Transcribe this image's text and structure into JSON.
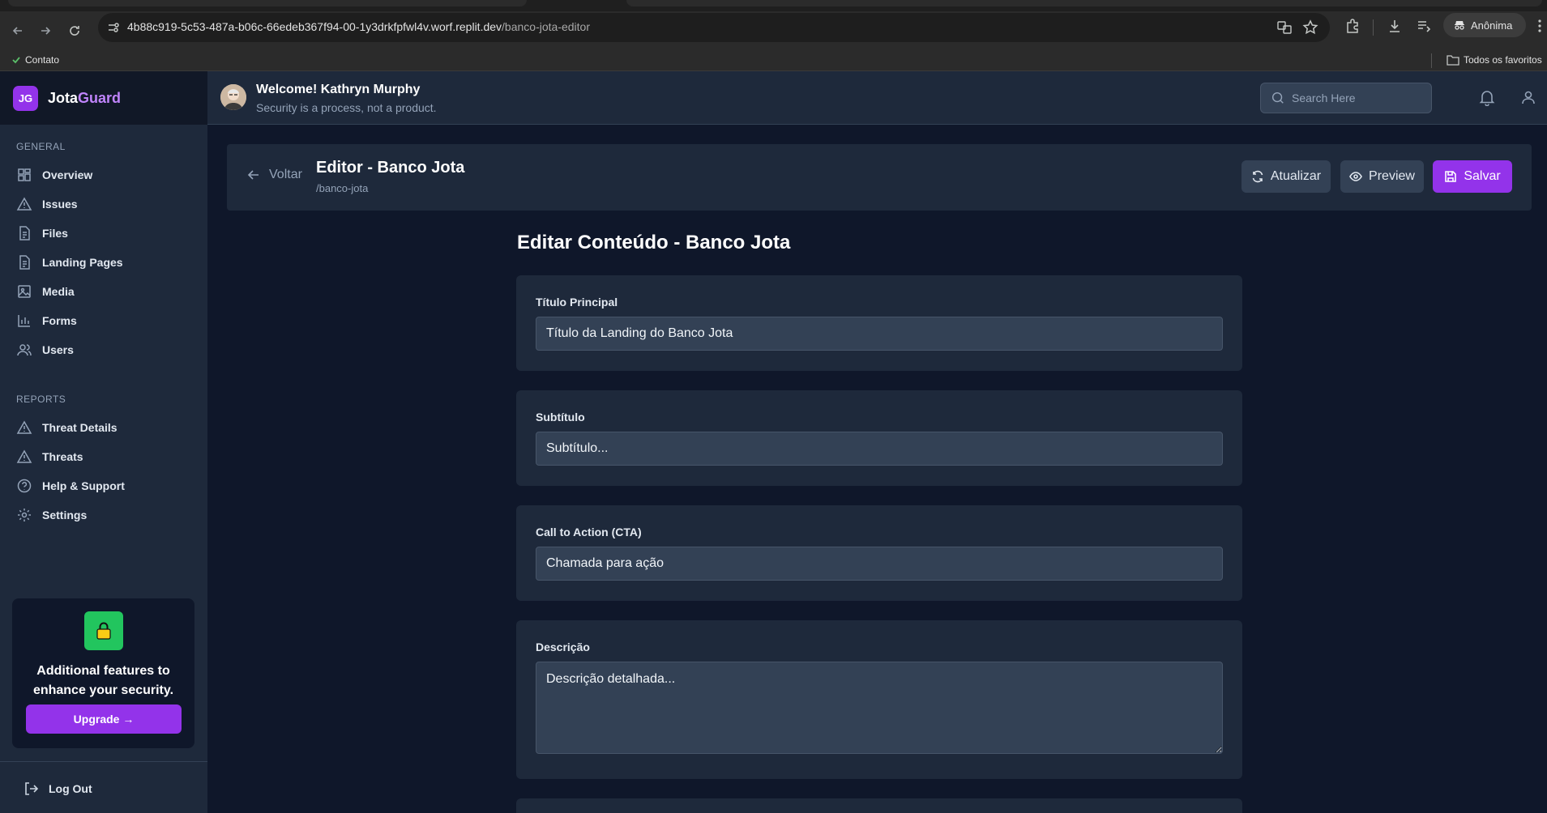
{
  "browser": {
    "url_host": "4b88c919-5c53-487a-b06c-66edeb367f94-00-1y3drkfpfwl4v.worf.replit.dev",
    "url_path": "/banco-jota-editor",
    "profile_label": "Anônima",
    "bookmark_contato": "Contato",
    "bookmark_favoritos": "Todos os favoritos"
  },
  "brand": {
    "badge": "JG",
    "name_part1": "Jota",
    "name_part2": "Guard"
  },
  "sidebar": {
    "general_label": "GENERAL",
    "general_items": [
      {
        "label": "Overview",
        "icon": "grid-icon"
      },
      {
        "label": "Issues",
        "icon": "warning-icon"
      },
      {
        "label": "Files",
        "icon": "file-icon"
      },
      {
        "label": "Landing Pages",
        "icon": "file-icon"
      },
      {
        "label": "Media",
        "icon": "image-icon"
      },
      {
        "label": "Forms",
        "icon": "bar-chart-icon"
      },
      {
        "label": "Users",
        "icon": "users-icon"
      }
    ],
    "reports_label": "REPORTS",
    "reports_items": [
      {
        "label": "Threat Details",
        "icon": "warning-icon"
      },
      {
        "label": "Threats",
        "icon": "warning-icon"
      },
      {
        "label": "Help & Support",
        "icon": "help-icon"
      },
      {
        "label": "Settings",
        "icon": "gear-icon"
      }
    ],
    "upgrade_text": "Additional features to enhance your security.",
    "upgrade_button": "Upgrade →",
    "logout": "Log Out"
  },
  "header": {
    "welcome": "Welcome! Kathryn Murphy",
    "tagline": "Security is a process, not a product.",
    "search_placeholder": "Search Here"
  },
  "editor": {
    "back_label": "Voltar",
    "title": "Editor - Banco Jota",
    "slug": "/banco-jota",
    "refresh_label": "Atualizar",
    "preview_label": "Preview",
    "save_label": "Salvar",
    "content_title": "Editar Conteúdo - Banco Jota"
  },
  "fields": {
    "main_title": {
      "label": "Título Principal",
      "placeholder": "Título da Landing do Banco Jota"
    },
    "subtitle": {
      "label": "Subtítulo",
      "placeholder": "Subtítulo..."
    },
    "cta": {
      "label": "Call to Action (CTA)",
      "placeholder": "Chamada para ação"
    },
    "description": {
      "label": "Descrição",
      "placeholder": "Descrição detalhada..."
    }
  },
  "colors": {
    "accent": "#9333ea",
    "sidebar_bg": "#1e293b",
    "page_bg": "#0f172a",
    "lock_tile": "#22c55e"
  }
}
